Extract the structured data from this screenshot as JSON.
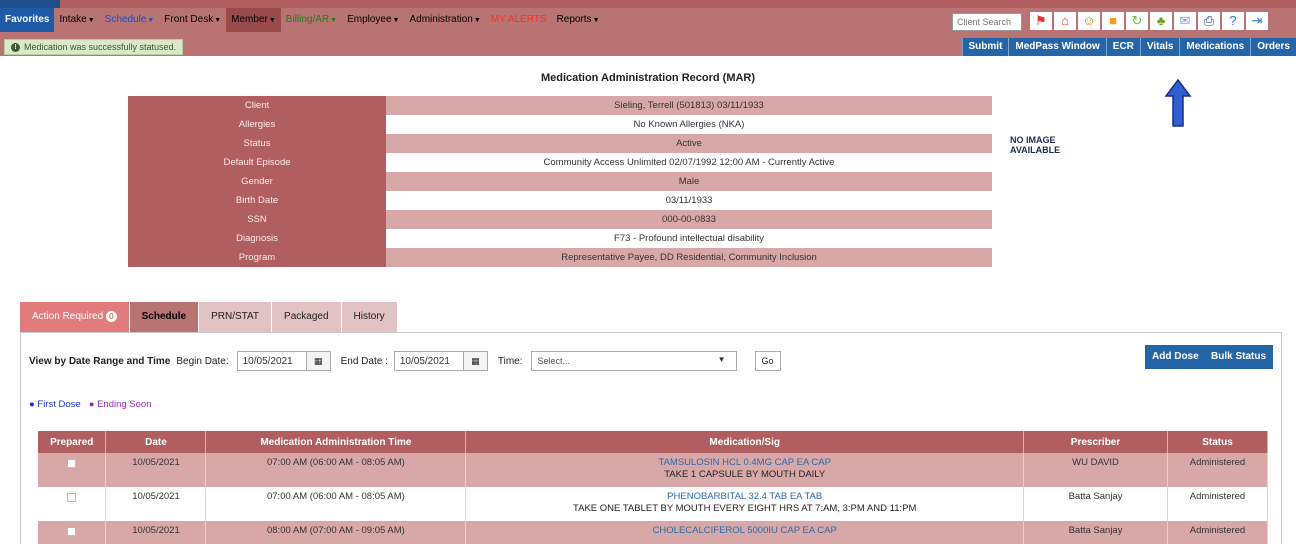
{
  "nav": {
    "items": [
      {
        "label": "Favorites",
        "style": "fav",
        "caret": false
      },
      {
        "label": "Intake",
        "style": "",
        "caret": true
      },
      {
        "label": "Schedule",
        "style": "blue",
        "caret": true
      },
      {
        "label": "Front Desk",
        "style": "",
        "caret": true
      },
      {
        "label": "Member",
        "style": "member",
        "caret": true
      },
      {
        "label": "Billing/AR",
        "style": "green",
        "caret": true
      },
      {
        "label": "Employee",
        "style": "",
        "caret": true
      },
      {
        "label": "Administration",
        "style": "",
        "caret": true
      },
      {
        "label": "MY ALERTS",
        "style": "red",
        "caret": false
      },
      {
        "label": "Reports",
        "style": "",
        "caret": true
      }
    ],
    "client_search_placeholder": "Client Search",
    "icons": [
      "flag-icon",
      "home-icon",
      "users-icon",
      "lock-icon",
      "refresh-icon",
      "tree-icon",
      "mail-icon",
      "print-icon",
      "help-icon",
      "logout-icon"
    ]
  },
  "alert": {
    "message": "Medication was successfully statused."
  },
  "actions": [
    "Submit",
    "MedPass Window",
    "ECR",
    "Vitals",
    "Medications",
    "Orders"
  ],
  "mar_title": "Medication Administration Record (MAR)",
  "client_info": [
    {
      "label": "Client",
      "value": "Sieling, Terrell (501813) 03/11/1933",
      "link": true
    },
    {
      "label": "Allergies",
      "value": "No Known Allergies (NKA)",
      "link": false
    },
    {
      "label": "Status",
      "value": "Active",
      "link": false
    },
    {
      "label": "Default Episode",
      "value": "Community Access Unlimited 02/07/1992 12:00 AM - Currently Active",
      "link": false
    },
    {
      "label": "Gender",
      "value": "Male",
      "link": false
    },
    {
      "label": "Birth Date",
      "value": "03/11/1933",
      "link": false
    },
    {
      "label": "SSN",
      "value": "000-00-0833",
      "link": false
    },
    {
      "label": "Diagnosis",
      "value": "F73 - Profound intellectual disability",
      "link": false
    },
    {
      "label": "Program",
      "value": "Representative Payee, DD Residential, Community Inclusion",
      "link": false
    }
  ],
  "no_image": {
    "line1": "NO IMAGE",
    "line2": "AVAILABLE"
  },
  "tabs": {
    "action_required": {
      "label": "Action Required",
      "count": "0"
    },
    "schedule": "Schedule",
    "prn_stat": "PRN/STAT",
    "packaged": "Packaged",
    "history": "History"
  },
  "filters": {
    "view_label": "View by Date Range and Time",
    "begin_label": "Begin Date:",
    "begin_value": "10/05/2021",
    "end_label": "End Date :",
    "end_value": "10/05/2021",
    "time_label": "Time:",
    "time_value": "Select...",
    "go_label": "Go"
  },
  "buttons": {
    "add_dose": "Add Dose",
    "bulk_status": "Bulk Status"
  },
  "legend": {
    "first_dose": "First Dose",
    "ending_soon": "Ending Soon"
  },
  "table": {
    "columns": [
      "Prepared",
      "Date",
      "Medication Administration Time",
      "Medication/Sig",
      "Prescriber",
      "Status"
    ],
    "rows": [
      {
        "date": "10/05/2021",
        "time": "07:00 AM (06:00 AM - 08:05 AM)",
        "medication": "TAMSULOSIN HCL 0.4MG CAP EA CAP",
        "sig": "TAKE 1 CAPSULE BY MOUTH DAILY",
        "prescriber": "WU DAVID",
        "status": "Administered"
      },
      {
        "date": "10/05/2021",
        "time": "07:00 AM (06:00 AM - 08:05 AM)",
        "medication": "PHENOBARBITAL 32.4 TAB EA TAB",
        "sig": "TAKE ONE TABLET BY MOUTH EVERY EIGHT HRS AT 7:AM, 3:PM AND 11:PM",
        "prescriber": "Batta Sanjay",
        "status": "Administered"
      },
      {
        "date": "10/05/2021",
        "time": "08:00 AM (07:00 AM - 09:05 AM)",
        "medication": "CHOLECALCIFEROL 5000IU CAP EA CAP",
        "sig": "",
        "prescriber": "Batta Sanjay",
        "status": "Administered"
      }
    ]
  },
  "colors": {
    "nav_bg": "#b97373",
    "header_maroon": "#b05e60",
    "row_pink": "#d8a8a8",
    "button_blue": "#2465a8"
  }
}
